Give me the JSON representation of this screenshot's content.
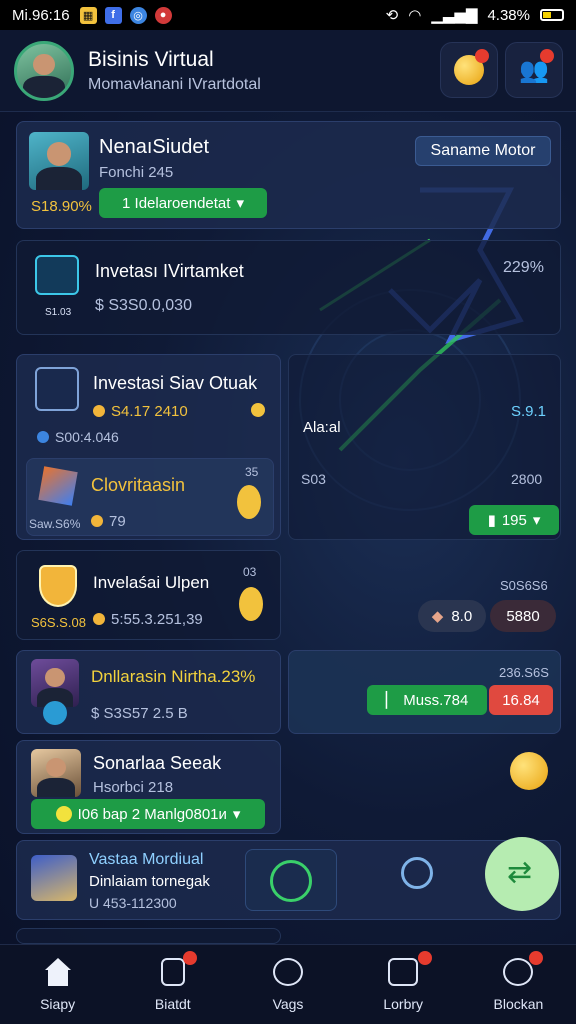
{
  "status": {
    "time": "Mi.96:16",
    "battery": "4.38%"
  },
  "header": {
    "title": "Bisinis Virtual",
    "subtitle": "Momavłanani IVrartdotal"
  },
  "profile_card": {
    "name": "NenaıSiudet",
    "sub": "Fonchi 245",
    "percent": "S18.90%",
    "dropdown": "1 Idelaroendetat",
    "badge": "Saname Motor"
  },
  "investasi_market": {
    "title": "Invetası IVirtamket",
    "value": "$ S3S0.0,030",
    "small": "S1.03",
    "percent": "229%"
  },
  "investasi_sav": {
    "title": "Investasi Siav Otuak",
    "line1": "S4.17 2410",
    "line2": "S00:4.046"
  },
  "chart_panel": {
    "label": "Ala:al",
    "left": "S03",
    "right": "2800",
    "value": "S.9.1",
    "pill": "195"
  },
  "clovrit": {
    "title": "Clovritaаsin",
    "num": "35",
    "left": "Saw.S6%",
    "value": "79"
  },
  "invelas_open": {
    "title": "Invelaśai Ulpen",
    "num": "03",
    "left": "S6S.S.08",
    "value": "5:55.3.251,39",
    "right_top": "S0S6S6",
    "btn1": "8.0",
    "btn2": "5880"
  },
  "dollar_card": {
    "title": "Dnllarasin Nirtha.23%",
    "value": "$ S3S57 2.5 B",
    "right_top": "236.S6S",
    "green": "Muss.784",
    "red": "16.84"
  },
  "sonarl_card": {
    "title": "Sonarlaa Seeak",
    "sub": "Hsorbci 218",
    "dropdown": "I06 bap 2 Manlg0801и"
  },
  "vastaa_card": {
    "title": "Vastaa Mordiual",
    "sub": "Dinlaiam tornegak",
    "value": "U 453-112300"
  },
  "nav": [
    {
      "label": "Siapy"
    },
    {
      "label": "Biatdt"
    },
    {
      "label": "Vags"
    },
    {
      "label": "Lorbry"
    },
    {
      "label": "Blockan"
    }
  ],
  "colors": {
    "accent_green": "#1e9c46",
    "accent_red": "#e0493f",
    "gold": "#f2c23d"
  }
}
